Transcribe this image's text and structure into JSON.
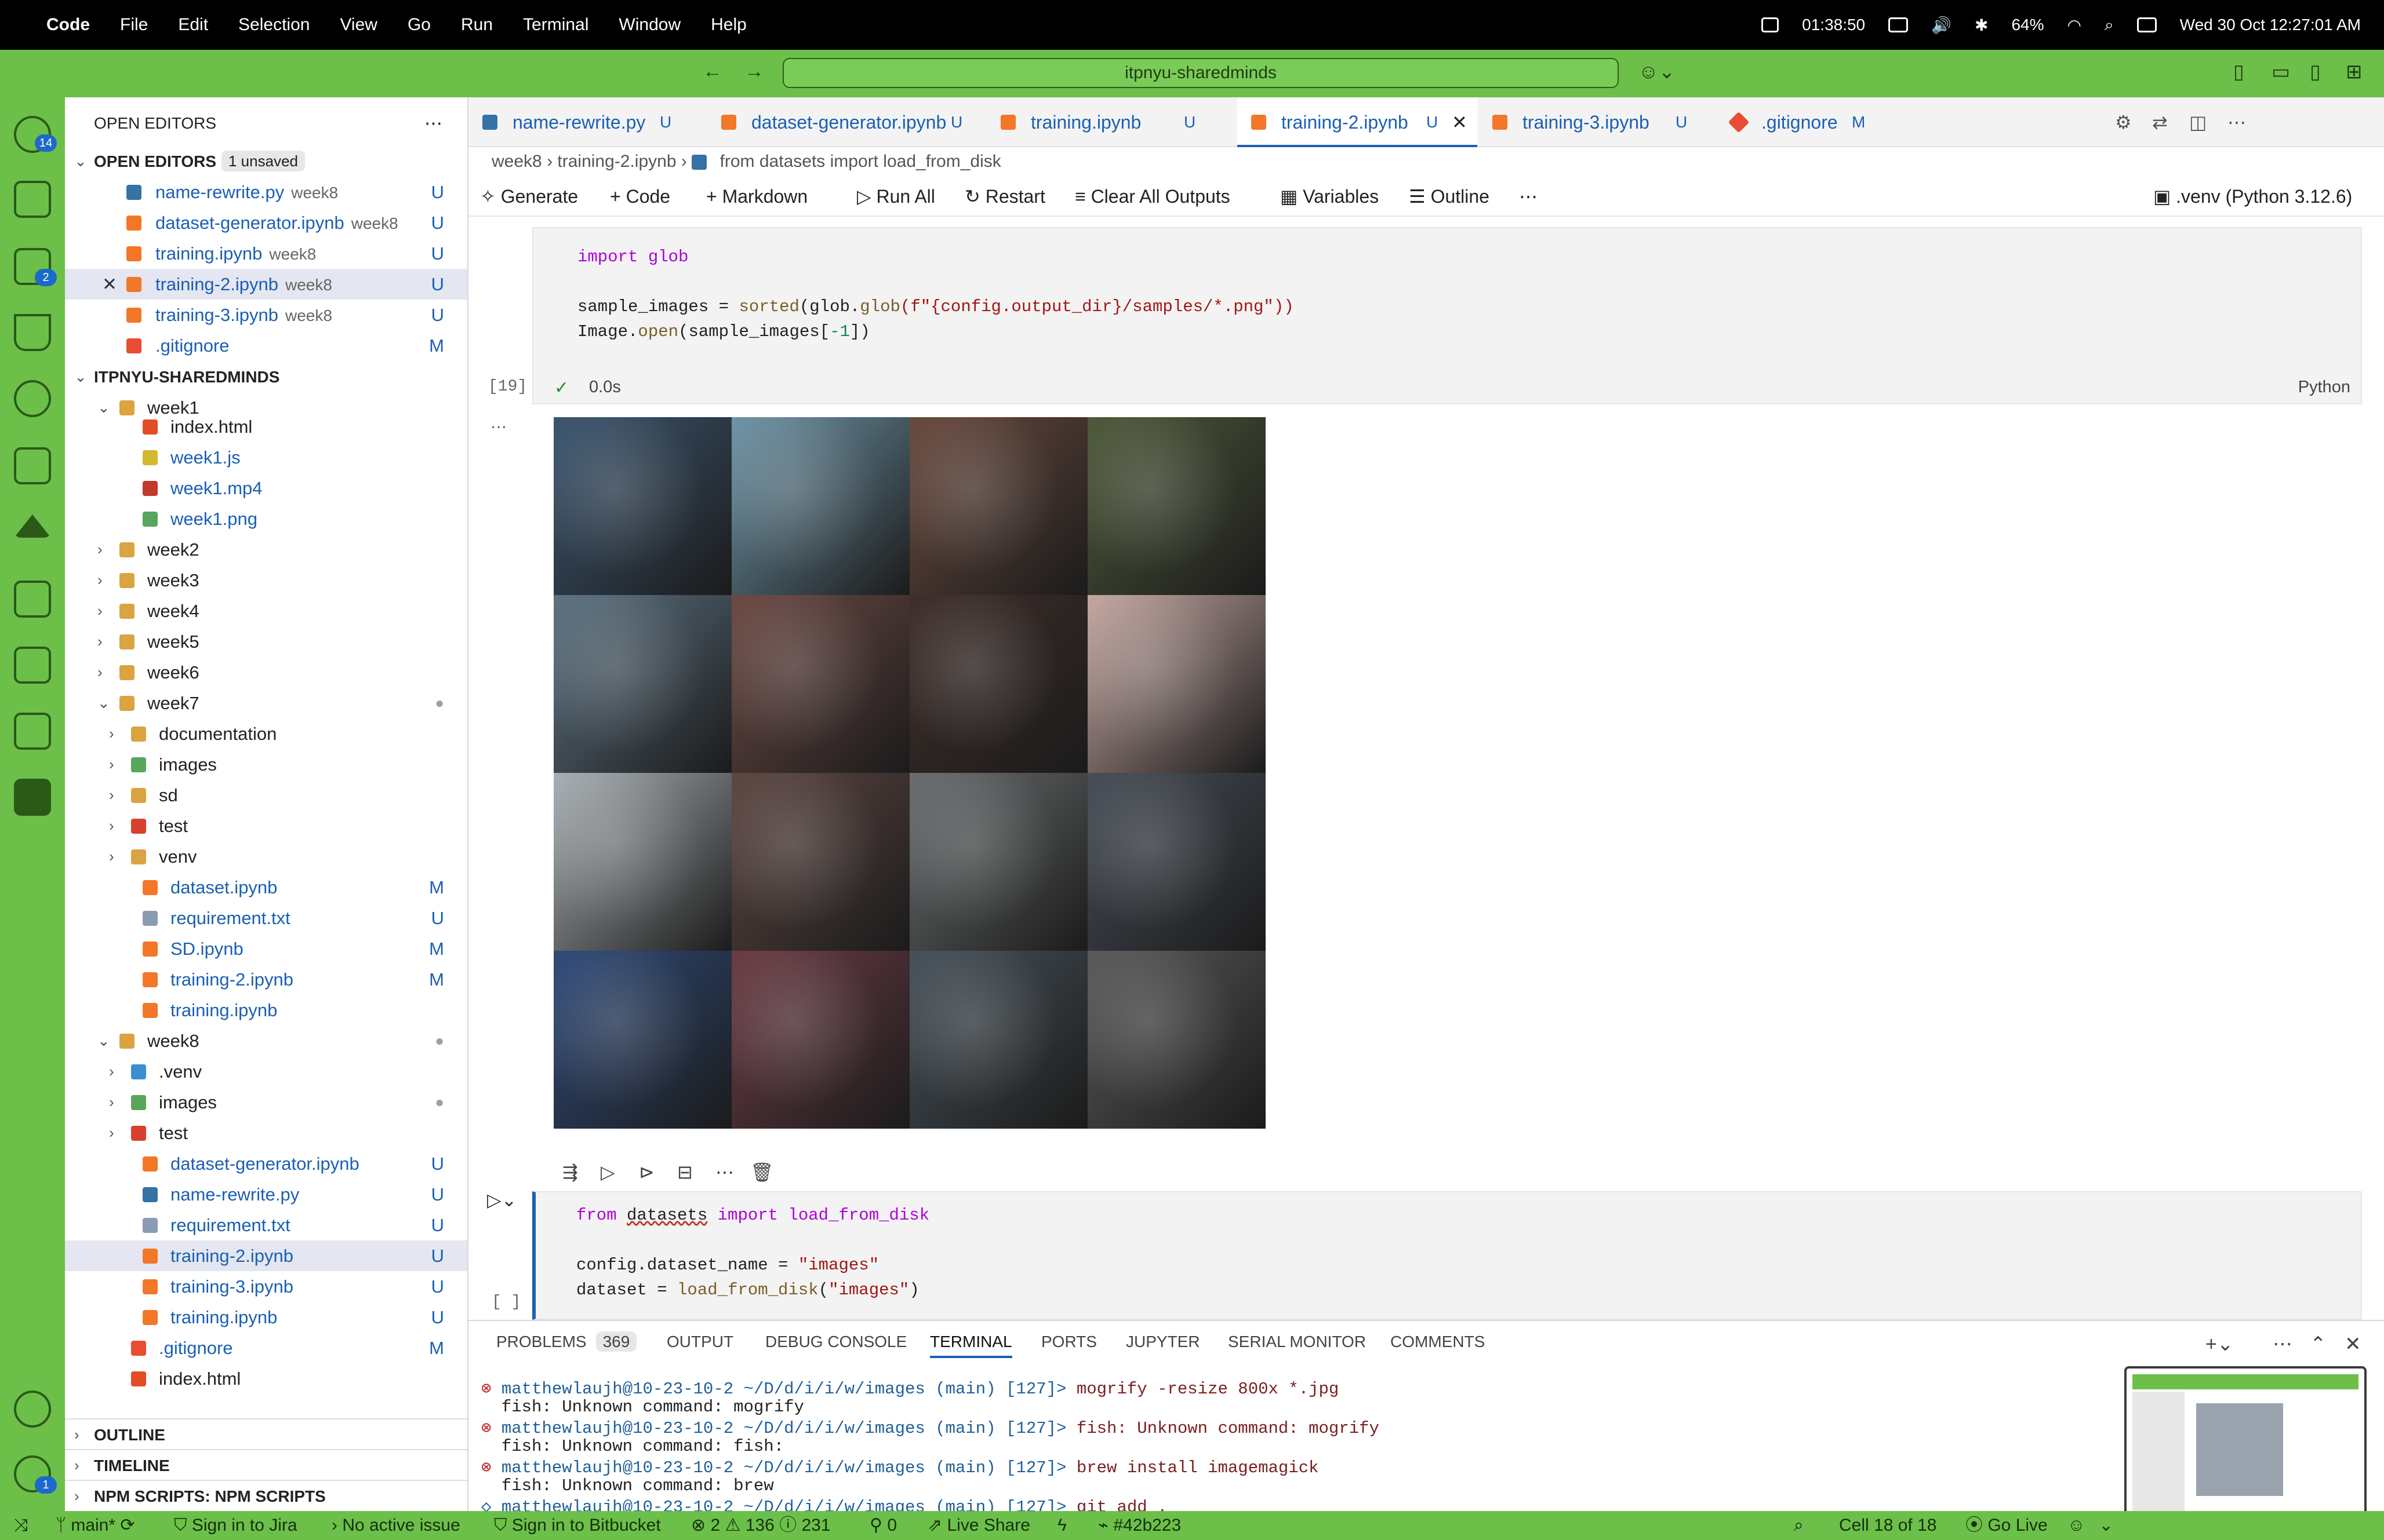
{
  "menubar": {
    "app": "Code",
    "items": [
      "File",
      "Edit",
      "Selection",
      "View",
      "Go",
      "Run",
      "Terminal",
      "Window",
      "Help"
    ],
    "timer": "01:38:50",
    "battery": "64%",
    "datetime": "Wed 30 Oct  12:27:01 AM"
  },
  "titlebar": {
    "search": "itpnyu-sharedminds"
  },
  "activity": {
    "scm_badge": "14",
    "ext_badge": "2",
    "settings_badge": "1"
  },
  "sidebar": {
    "open_editors_title": "OPEN EDITORS",
    "open_editors_heading": "OPEN EDITORS",
    "unsaved": "1 unsaved",
    "open_editors": [
      {
        "name": "name-rewrite.py",
        "desc": "week8",
        "status": "U"
      },
      {
        "name": "dataset-generator.ipynb",
        "desc": "week8",
        "status": "U"
      },
      {
        "name": "training.ipynb",
        "desc": "week8",
        "status": "U"
      },
      {
        "name": "training-2.ipynb",
        "desc": "week8",
        "status": "U"
      },
      {
        "name": "training-3.ipynb",
        "desc": "week8",
        "status": "U"
      },
      {
        "name": ".gitignore",
        "desc": "",
        "status": "M"
      }
    ],
    "workspace": "ITPNYU-SHAREDMINDS",
    "tree": [
      {
        "name": "week1"
      },
      {
        "name": "index.html"
      },
      {
        "name": "week1.js"
      },
      {
        "name": "week1.mp4"
      },
      {
        "name": "week1.png"
      },
      {
        "name": "week2"
      },
      {
        "name": "week3"
      },
      {
        "name": "week4"
      },
      {
        "name": "week5"
      },
      {
        "name": "week6"
      },
      {
        "name": "week7"
      },
      {
        "name": "documentation"
      },
      {
        "name": "images"
      },
      {
        "name": "sd"
      },
      {
        "name": "test"
      },
      {
        "name": "venv"
      },
      {
        "name": "dataset.ipynb",
        "status": "M"
      },
      {
        "name": "requirement.txt",
        "status": "U"
      },
      {
        "name": "SD.ipynb",
        "status": "M"
      },
      {
        "name": "training-2.ipynb",
        "status": "M"
      },
      {
        "name": "training.ipynb"
      },
      {
        "name": "week8"
      },
      {
        "name": ".venv"
      },
      {
        "name": "images"
      },
      {
        "name": "test"
      },
      {
        "name": "dataset-generator.ipynb",
        "status": "U"
      },
      {
        "name": "name-rewrite.py",
        "status": "U"
      },
      {
        "name": "requirement.txt",
        "status": "U"
      },
      {
        "name": "training-2.ipynb",
        "status": "U"
      },
      {
        "name": "training-3.ipynb",
        "status": "U"
      },
      {
        "name": "training.ipynb",
        "status": "U"
      },
      {
        "name": ".gitignore",
        "status": "M"
      },
      {
        "name": "index.html"
      }
    ],
    "outline": "OUTLINE",
    "timeline": "TIMELINE",
    "npm": "NPM SCRIPTS: NPM SCRIPTS"
  },
  "tabs": [
    {
      "name": "name-rewrite.py",
      "status": "U"
    },
    {
      "name": "dataset-generator.ipynb",
      "status": "U"
    },
    {
      "name": "training.ipynb",
      "status": "U"
    },
    {
      "name": "training-2.ipynb",
      "status": "U"
    },
    {
      "name": "training-3.ipynb",
      "status": "U"
    },
    {
      "name": ".gitignore",
      "status": "M"
    }
  ],
  "breadcrumb": [
    "week8",
    "training-2.ipynb",
    "from datasets import load_from_disk"
  ],
  "nbtoolbar": {
    "generate": "Generate",
    "code": "Code",
    "markdown": "Markdown",
    "run_all": "Run All",
    "restart": "Restart",
    "clear": "Clear All Outputs",
    "variables": "Variables",
    "outline": "Outline",
    "kernel": ".venv (Python 3.12.6)"
  },
  "cell1": {
    "exec": "[19]",
    "time": "0.0s",
    "lang": "Python",
    "l1": "import glob",
    "l2a": "sample_images = ",
    "l2b": "sorted",
    "l2c": "(glob.",
    "l2d": "glob",
    "l2e": "(f\"{config.output_dir}/samples/*.png\"))",
    "l3a": "Image.",
    "l3b": "open",
    "l3c": "(sample_images[",
    "l3d": "-1",
    "l3e": "])"
  },
  "output_grid": {
    "tiles": [
      "#3c5670",
      "#6f95a8",
      "#6a4a3e",
      "#4e5a3a",
      "#5e7484",
      "#6d4a44",
      "#3f2e2a",
      "#c6a8a2",
      "#aab1b5",
      "#5e4742",
      "#6a6e70",
      "#474e58",
      "#2f4b7a",
      "#6c3c44",
      "#47525a",
      "#5a5a5a"
    ]
  },
  "cell2": {
    "exec": "[ ]",
    "l1a": "from ",
    "l1b": "datasets",
    "l1c": " import load_from_disk",
    "l2a": "config.dataset_name = ",
    "l2b": "\"images\"",
    "l3a": "dataset = ",
    "l3b": "load_from_disk",
    "l3c": "(",
    "l3d": "\"images\"",
    "l3e": ")"
  },
  "panel": {
    "tabs": [
      "PROBLEMS",
      "OUTPUT",
      "DEBUG CONSOLE",
      "TERMINAL",
      "PORTS",
      "JUPYTER",
      "SERIAL MONITOR",
      "COMMENTS"
    ],
    "problems_count": "369",
    "lines": [
      {
        "prompt": "matthewlaujh@10-23-10-2 ~/D/d/i/i/w/images (main) [127]> ",
        "cmd": "mogrify -resize 800x *.jpg"
      },
      {
        "out": "fish: Unknown command: mogrify"
      },
      {
        "prompt": "matthewlaujh@10-23-10-2 ~/D/d/i/i/w/images (main) [127]> ",
        "cmd": "fish: Unknown command: mogrify"
      },
      {
        "out": "fish: Unknown command: fish:"
      },
      {
        "prompt": "matthewlaujh@10-23-10-2 ~/D/d/i/i/w/images (main) [127]> ",
        "cmd": "brew install imagemagick"
      },
      {
        "out": "fish: Unknown command: brew"
      },
      {
        "prompt": "matthewlaujh@10-23-10-2 ~/D/d/i/i/w/images (main) [127]> ",
        "cmd": "git add ."
      }
    ]
  },
  "statusbar": {
    "branch": "main*",
    "jira": "Sign in to Jira",
    "issue": "No active issue",
    "bitbucket": "Sign in to Bitbucket",
    "errors": "2",
    "warnings": "136",
    "info": "231",
    "ports": "0",
    "liveshare": "Live Share",
    "commit": "#42b223",
    "cell": "Cell 18 of 18",
    "golive": "Go Live"
  }
}
